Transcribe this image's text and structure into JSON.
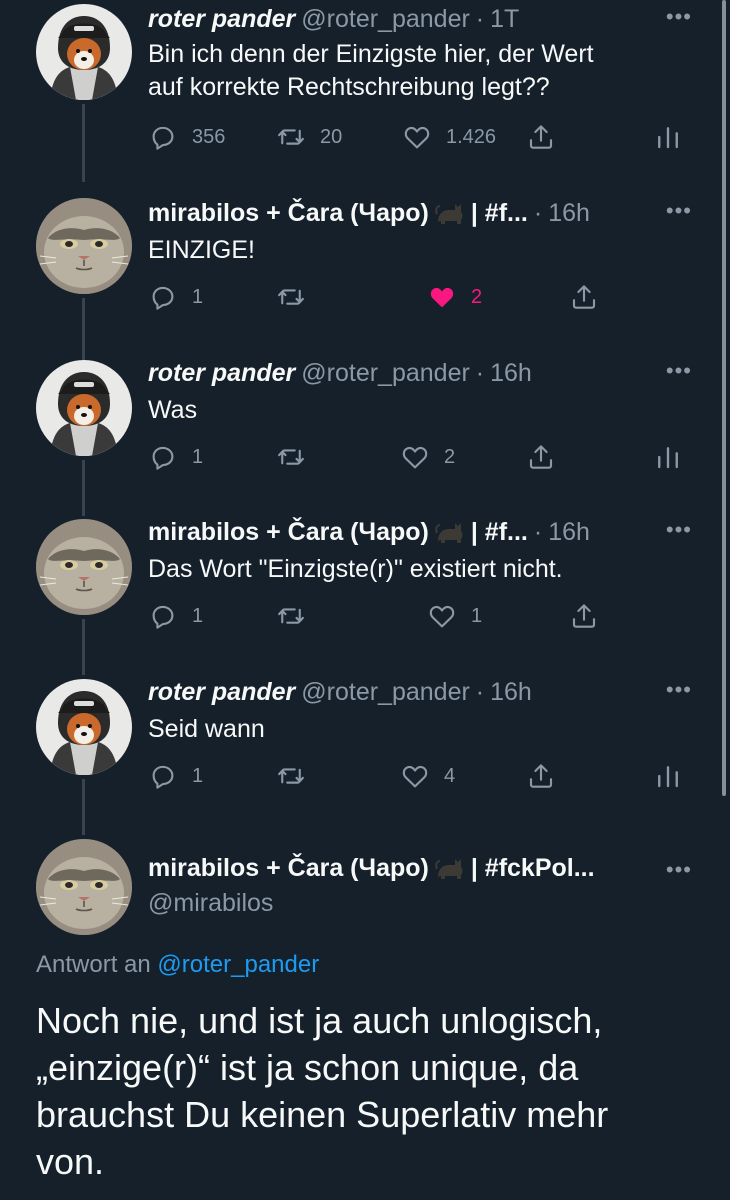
{
  "tweets": [
    {
      "name": "roter pander",
      "handle": "@roter_pander",
      "time": "1T",
      "text_lines": [
        "Bin ich denn der Einzigste hier, der Wert",
        "auf korrekte Rechtschreibung legt??"
      ],
      "replies": "356",
      "retweets": "20",
      "likes": "1.426"
    },
    {
      "name": "mirabilos + Čara (Чаро)",
      "name_suffix": "| #f...",
      "time": "16h",
      "text_lines": [
        "EINZIGE!"
      ],
      "replies": "1",
      "retweets": "",
      "likes": "2"
    },
    {
      "name": "roter pander",
      "handle": "@roter_pander",
      "time": "16h",
      "text_lines": [
        "Was"
      ],
      "replies": "1",
      "retweets": "",
      "likes": "2"
    },
    {
      "name": "mirabilos + Čara (Чаро)",
      "name_suffix": "| #f...",
      "time": "16h",
      "text_lines": [
        "Das Wort \"Einzigste(r)\" existiert nicht."
      ],
      "replies": "1",
      "retweets": "",
      "likes": "1"
    },
    {
      "name": "roter pander",
      "handle": "@roter_pander",
      "time": "16h",
      "text_lines": [
        "Seid wann"
      ],
      "replies": "1",
      "retweets": "",
      "likes": "4"
    }
  ],
  "main_tweet": {
    "name": "mirabilos + Čara (Чаро)",
    "name_suffix": "| #fckPol...",
    "handle": "@mirabilos",
    "reply_label": "Antwort an",
    "reply_mention": "@roter_pander",
    "text_lines": [
      "Noch nie, und ist ja auch unlogisch,",
      "„einzige(r)“ ist ja schon unique, da",
      "brauchst Du keinen Superlativ mehr",
      "von."
    ]
  },
  "more_glyph": "•••",
  "colors": {
    "background": "#15202b",
    "text": "#f7f9f9",
    "muted": "#8b98a5",
    "link": "#1d9bf0",
    "like": "#f91880",
    "thread_line": "#38444d"
  },
  "icons": [
    "reply-icon",
    "retweet-icon",
    "like-icon",
    "share-icon",
    "analytics-icon",
    "more-icon",
    "cat-emoji"
  ]
}
